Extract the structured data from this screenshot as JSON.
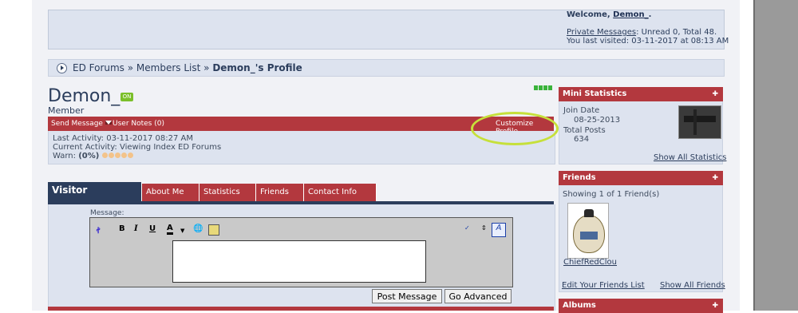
{
  "header": {
    "welcome_prefix": "Welcome, ",
    "username_link": "Demon_",
    "welcome_suffix": ".",
    "private_messages_link": "Private Messages",
    "private_messages_status": ": Unread 0, Total 48.",
    "last_visited": "You last visited: 03-11-2017 at 08:13 AM"
  },
  "breadcrumb": {
    "forums": "ED Forums",
    "sep1": " » ",
    "members": "Members List",
    "sep2": " » ",
    "current": "Demon_'s Profile"
  },
  "profile": {
    "username": "Demon_",
    "online_badge": "ON",
    "user_title": "Member",
    "send_message": "Send Message",
    "user_notes": "User Notes (0)",
    "customize_profile": "Customize Profile",
    "last_activity": "Last Activity: 03-11-2017 08:27 AM",
    "current_activity_prefix": "Current Activity: Viewing Index ",
    "current_activity_link": "ED Forums",
    "warn_label": "Warn: ",
    "warn_value": "(0%)",
    "reputation_pips": 4
  },
  "tabs": [
    {
      "label": "Visitor Messages",
      "active": true
    },
    {
      "label": "About Me",
      "active": false
    },
    {
      "label": "Statistics",
      "active": false
    },
    {
      "label": "Friends",
      "active": false
    },
    {
      "label": "Contact Info",
      "active": false
    }
  ],
  "editor": {
    "message_label": "Message:",
    "bold": "B",
    "italic": "I",
    "underline": "U",
    "font_color": "A",
    "post_button": "Post Message",
    "advanced_button": "Go Advanced",
    "textarea_value": ""
  },
  "sidebar": {
    "mini_stats": {
      "title": "Mini Statistics",
      "join_label": "Join Date",
      "join_value": "08-25-2013",
      "posts_label": "Total Posts",
      "posts_value": "634",
      "show_all": "Show All Statistics"
    },
    "friends": {
      "title": "Friends",
      "showing": "Showing 1 of 1 Friend(s)",
      "friend_name": "ChiefRedClou",
      "edit_link": "Edit Your Friends List",
      "show_all": "Show All Friends"
    },
    "albums": {
      "title": "Albums"
    }
  },
  "colors": {
    "accent_red": "#b3383e",
    "navy": "#2b3d5c",
    "panel": "#dde3ef",
    "highlight_circle": "#c6e03a",
    "online_green": "#7bbf2a"
  }
}
